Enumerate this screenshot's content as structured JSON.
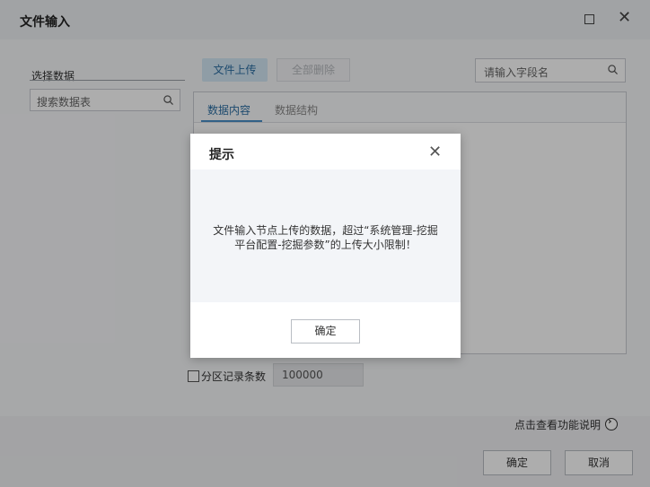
{
  "window": {
    "title": "文件输入"
  },
  "left": {
    "label": "选择数据",
    "search_placeholder": "搜索数据表"
  },
  "toolbar": {
    "upload_label": "文件上传",
    "delete_all_label": "全部删除",
    "field_search_placeholder": "请输入字段名"
  },
  "tabs": [
    {
      "label": "数据内容",
      "active": true
    },
    {
      "label": "数据结构",
      "active": false
    }
  ],
  "partition": {
    "label": "分区记录条数",
    "value": "100000",
    "checked": false
  },
  "footer": {
    "help_label": "点击查看功能说明",
    "confirm_label": "确定",
    "cancel_label": "取消"
  },
  "dialog": {
    "title": "提示",
    "message_line1": "文件输入节点上传的数据，超过“系统管理-挖掘",
    "message_line2": "平台配置-挖掘参数”的上传大小限制！",
    "ok_label": "确定"
  },
  "colors": {
    "accent": "#2b6ea3",
    "upload_bg": "#d3e7f5",
    "overlay": "rgba(0,0,0,0.32)"
  },
  "icons": [
    "search-icon",
    "maximize-icon",
    "close-icon",
    "help-arrow-icon"
  ]
}
